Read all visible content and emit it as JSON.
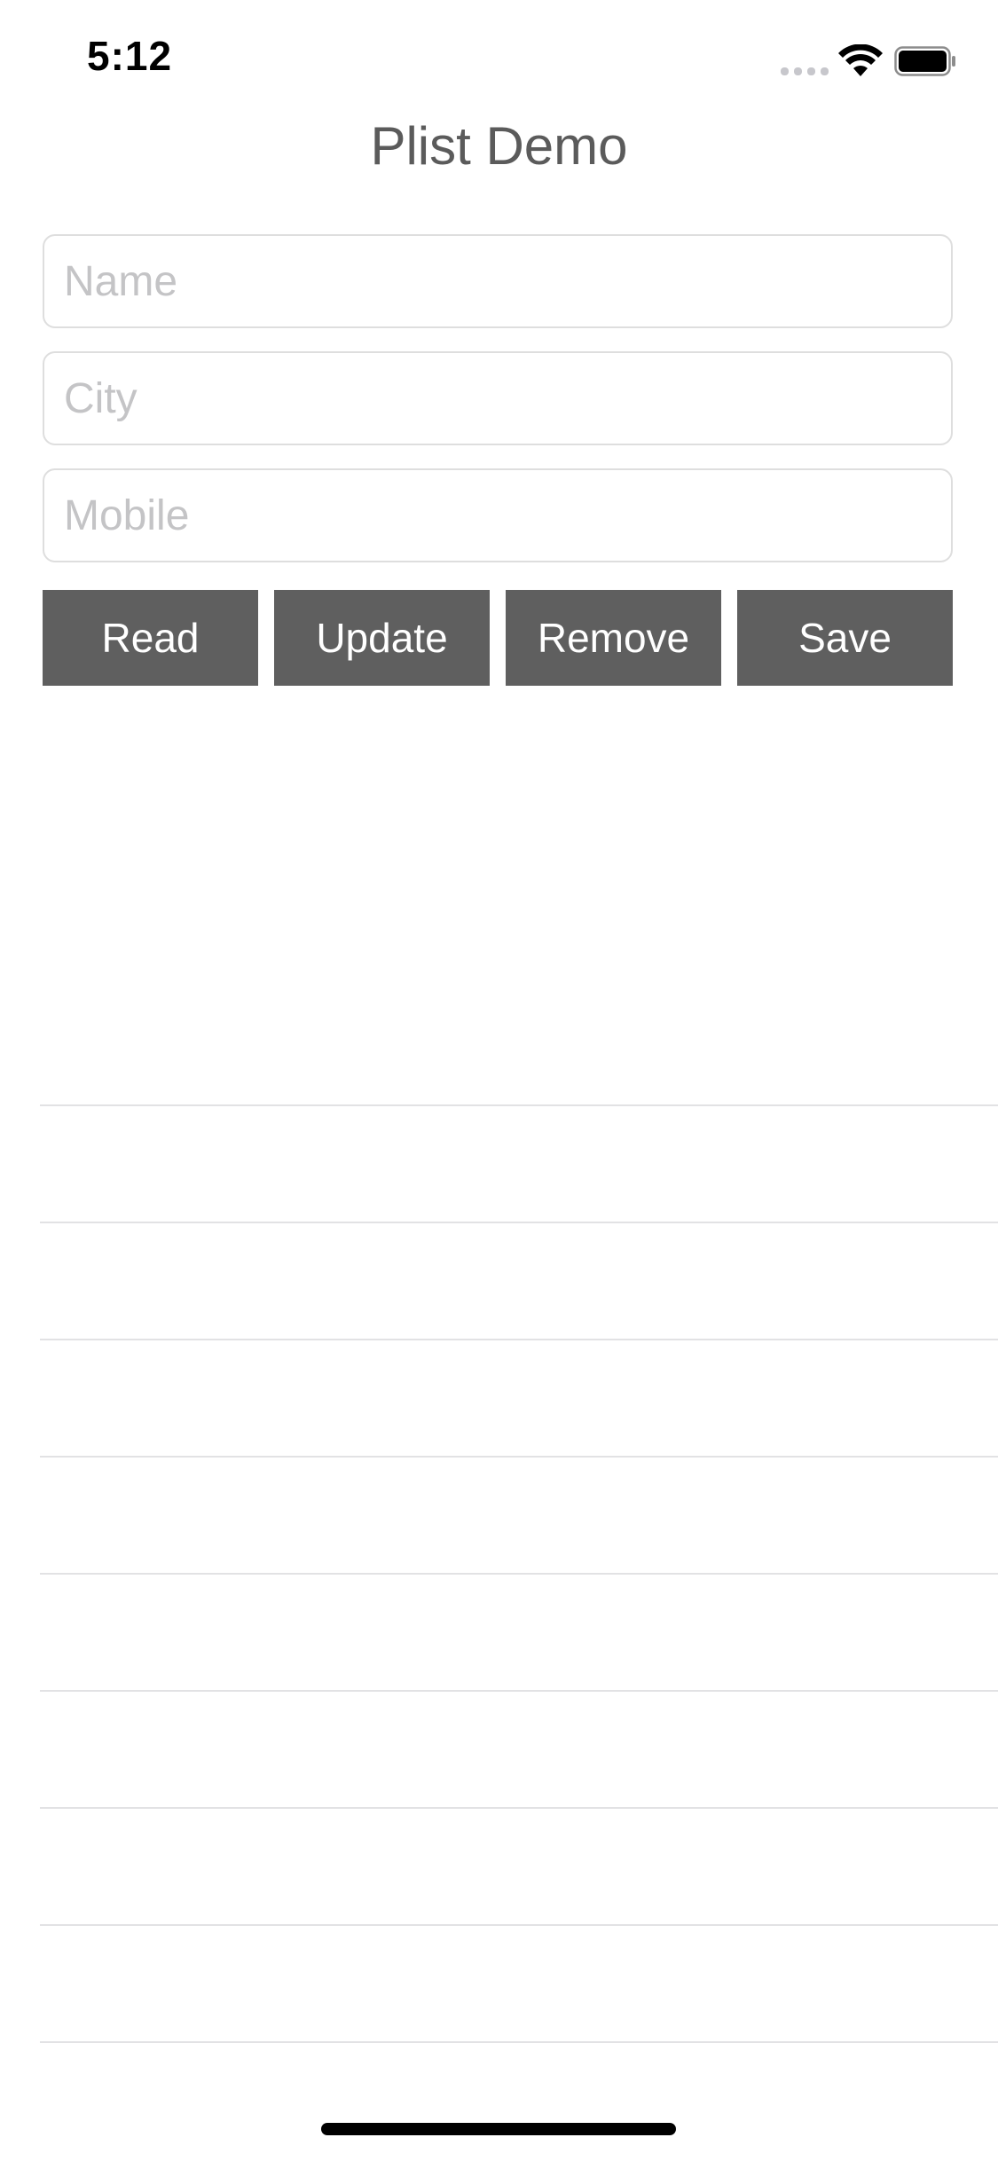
{
  "status_bar": {
    "time": "5:12",
    "icons": [
      "cellular-signal-icon",
      "wifi-icon",
      "battery-icon"
    ]
  },
  "nav": {
    "title": "Plist Demo"
  },
  "form": {
    "name": {
      "value": "",
      "placeholder": "Name"
    },
    "city": {
      "value": "",
      "placeholder": "City"
    },
    "mobile": {
      "value": "",
      "placeholder": "Mobile"
    }
  },
  "buttons": {
    "read": "Read",
    "update": "Update",
    "remove": "Remove",
    "save": "Save"
  },
  "table": {
    "rows": []
  },
  "colors": {
    "button_background": "#5f5f5f",
    "title_text": "#5b5b5b",
    "placeholder_text": "#c4c4c6",
    "separator": "#e2e2e4"
  }
}
